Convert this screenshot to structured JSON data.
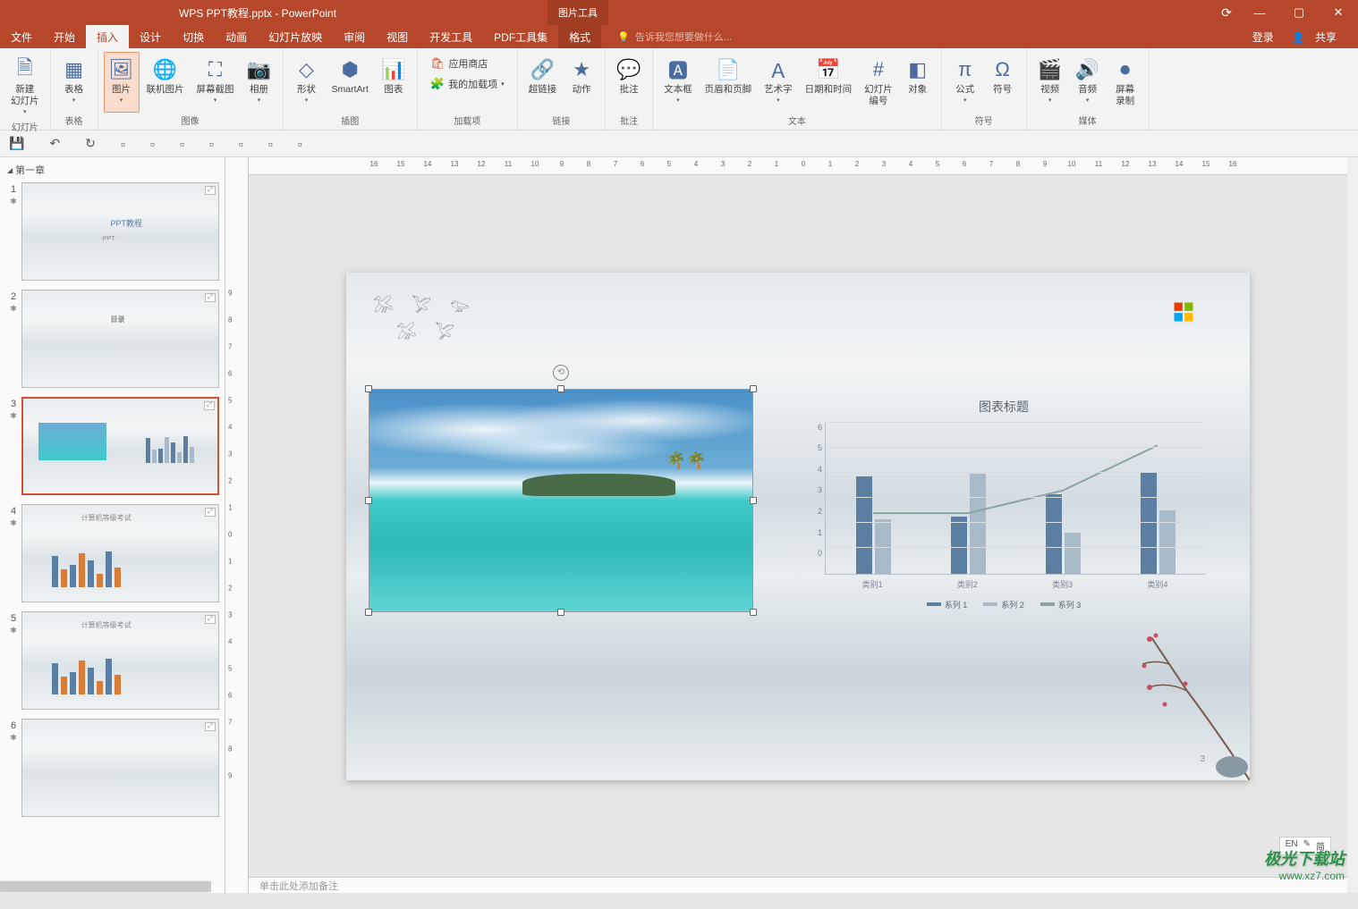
{
  "titlebar": {
    "doc_title": "WPS PPT教程.pptx - PowerPoint",
    "context_tab": "图片工具"
  },
  "window_controls": {
    "autosave_icon": "⟳",
    "min": "—",
    "max": "▢",
    "close": "✕"
  },
  "menubar": {
    "tabs": [
      "文件",
      "开始",
      "插入",
      "设计",
      "切换",
      "动画",
      "幻灯片放映",
      "审阅",
      "视图",
      "开发工具",
      "PDF工具集"
    ],
    "active_index": 2,
    "format_tab": "格式",
    "tellme_placeholder": "告诉我您想要做什么...",
    "login": "登录",
    "share": "共享"
  },
  "ribbon": {
    "groups": [
      {
        "label": "幻灯片",
        "items": [
          {
            "name": "new-slide",
            "text": "新建\n幻灯片",
            "dd": true
          }
        ]
      },
      {
        "label": "表格",
        "items": [
          {
            "name": "table",
            "text": "表格",
            "dd": true
          }
        ]
      },
      {
        "label": "图像",
        "items": [
          {
            "name": "picture",
            "text": "图片",
            "dd": true,
            "active": true
          },
          {
            "name": "online-picture",
            "text": "联机图片"
          },
          {
            "name": "screenshot",
            "text": "屏幕截图",
            "dd": true
          },
          {
            "name": "album",
            "text": "相册",
            "dd": true
          }
        ]
      },
      {
        "label": "插图",
        "items": [
          {
            "name": "shapes",
            "text": "形状",
            "dd": true
          },
          {
            "name": "smartart",
            "text": "SmartArt"
          },
          {
            "name": "chart",
            "text": "图表"
          }
        ]
      },
      {
        "label": "加载项",
        "stack": [
          {
            "name": "store",
            "text": "应用商店"
          },
          {
            "name": "my-addins",
            "text": "我的加载项",
            "dd": true
          }
        ]
      },
      {
        "label": "链接",
        "items": [
          {
            "name": "hyperlink",
            "text": "超链接"
          },
          {
            "name": "action",
            "text": "动作"
          }
        ]
      },
      {
        "label": "批注",
        "items": [
          {
            "name": "comment",
            "text": "批注"
          }
        ]
      },
      {
        "label": "文本",
        "items": [
          {
            "name": "textbox",
            "text": "文本框",
            "dd": true
          },
          {
            "name": "header-footer",
            "text": "页眉和页脚"
          },
          {
            "name": "wordart",
            "text": "艺术字",
            "dd": true
          },
          {
            "name": "date-time",
            "text": "日期和时间"
          },
          {
            "name": "slide-number",
            "text": "幻灯片\n编号"
          },
          {
            "name": "object",
            "text": "对象"
          }
        ]
      },
      {
        "label": "符号",
        "items": [
          {
            "name": "equation",
            "text": "公式",
            "dd": true
          },
          {
            "name": "symbol",
            "text": "符号"
          }
        ]
      },
      {
        "label": "媒体",
        "items": [
          {
            "name": "video",
            "text": "视频",
            "dd": true
          },
          {
            "name": "audio",
            "text": "音频",
            "dd": true
          },
          {
            "name": "screen-record",
            "text": "屏幕\n录制"
          }
        ]
      }
    ]
  },
  "section_name": "第一章",
  "thumbnails": [
    1,
    2,
    3,
    4,
    5,
    6
  ],
  "selected_slide": 3,
  "slide": {
    "page_number": "3"
  },
  "chart_data": {
    "type": "bar+line",
    "title": "图表标题",
    "categories": [
      "类别1",
      "类别2",
      "类别3",
      "类别4"
    ],
    "series": [
      {
        "name": "系列 1",
        "type": "bar",
        "values": [
          4.3,
          2.5,
          3.5,
          4.5
        ],
        "color": "#5b7ea3"
      },
      {
        "name": "系列 2",
        "type": "bar",
        "values": [
          2.4,
          4.4,
          1.8,
          2.8
        ],
        "color": "#a8b9c8"
      },
      {
        "name": "系列 3",
        "type": "line",
        "values": [
          2.0,
          2.0,
          3.0,
          5.0
        ],
        "color": "#8aa5a0"
      }
    ],
    "ylim": [
      0,
      6
    ],
    "yticks": [
      0,
      1,
      2,
      3,
      4,
      5,
      6
    ]
  },
  "notes_placeholder": "单击此处添加备注",
  "status": {
    "lang": "EN",
    "ime": "简"
  },
  "watermark": {
    "line1": "极光下载站",
    "line2": "www.xz7.com"
  },
  "ruler_h": [
    -16,
    -15,
    -14,
    -13,
    -12,
    -11,
    -10,
    -9,
    -8,
    -7,
    -6,
    -5,
    -4,
    -3,
    -2,
    -1,
    0,
    1,
    2,
    3,
    4,
    5,
    6,
    7,
    8,
    9,
    10,
    11,
    12,
    13,
    14,
    15,
    16
  ],
  "ruler_v": [
    -9,
    -8,
    -7,
    -6,
    -5,
    -4,
    -3,
    -2,
    -1,
    0,
    1,
    2,
    3,
    4,
    5,
    6,
    7,
    8,
    9
  ]
}
